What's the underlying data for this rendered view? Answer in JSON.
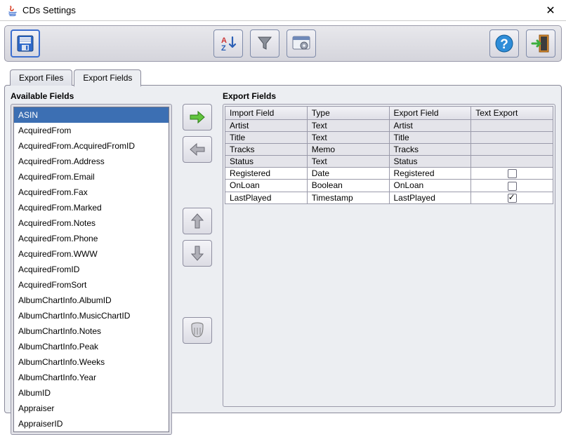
{
  "window": {
    "title": "CDs Settings"
  },
  "tabs": [
    {
      "label": "Export Files",
      "active": false
    },
    {
      "label": "Export Fields",
      "active": true
    }
  ],
  "left": {
    "title": "Available Fields",
    "items": [
      "ASIN",
      "AcquiredFrom",
      "AcquiredFrom.AcquiredFromID",
      "AcquiredFrom.Address",
      "AcquiredFrom.Email",
      "AcquiredFrom.Fax",
      "AcquiredFrom.Marked",
      "AcquiredFrom.Notes",
      "AcquiredFrom.Phone",
      "AcquiredFrom.WWW",
      "AcquiredFromID",
      "AcquiredFromSort",
      "AlbumChartInfo.AlbumID",
      "AlbumChartInfo.MusicChartID",
      "AlbumChartInfo.Notes",
      "AlbumChartInfo.Peak",
      "AlbumChartInfo.Weeks",
      "AlbumChartInfo.Year",
      "AlbumID",
      "Appraiser",
      "AppraiserID"
    ],
    "selectedIndex": 0
  },
  "right": {
    "title": "Export Fields",
    "columns": [
      "Import Field",
      "Type",
      "Export Field",
      "Text Export"
    ],
    "rows": [
      {
        "import": "Artist",
        "type": "Text",
        "export": "Artist",
        "text_export": null,
        "shaded": true
      },
      {
        "import": "Title",
        "type": "Text",
        "export": "Title",
        "text_export": null,
        "shaded": true
      },
      {
        "import": "Tracks",
        "type": "Memo",
        "export": "Tracks",
        "text_export": null,
        "shaded": true
      },
      {
        "import": "Status",
        "type": "Text",
        "export": "Status",
        "text_export": null,
        "shaded": true
      },
      {
        "import": "Registered",
        "type": "Date",
        "export": "Registered",
        "text_export": false,
        "shaded": false
      },
      {
        "import": "OnLoan",
        "type": "Boolean",
        "export": "OnLoan",
        "text_export": false,
        "shaded": false
      },
      {
        "import": "LastPlayed",
        "type": "Timestamp",
        "export": "LastPlayed",
        "text_export": true,
        "shaded": false
      }
    ]
  }
}
